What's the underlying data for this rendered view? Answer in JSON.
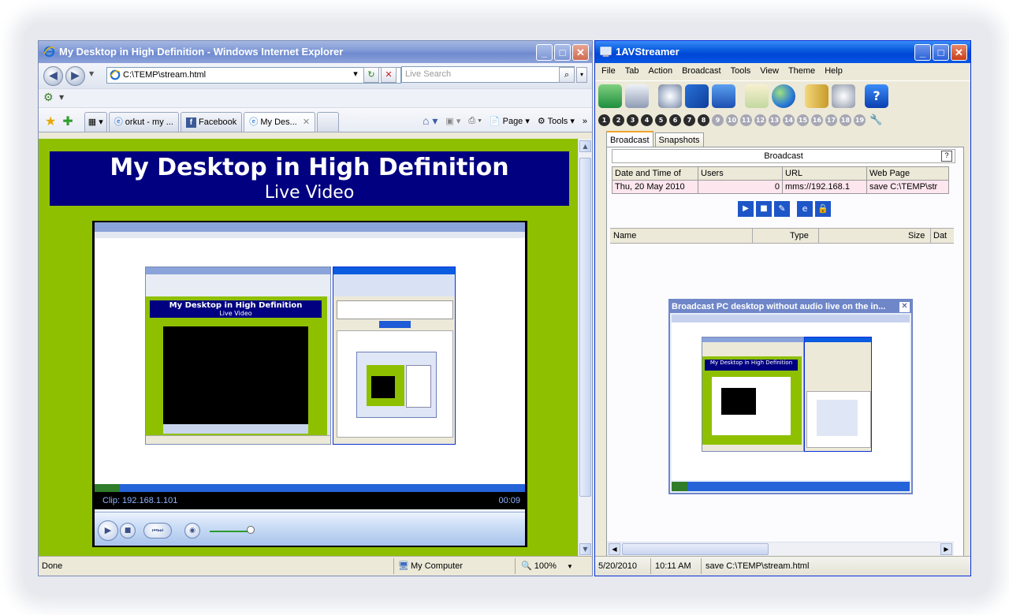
{
  "colors": {
    "ie_title": "#7f99d6",
    "av_title": "#0a5ce0",
    "page_green": "#8ec000",
    "banner_navy": "#000080"
  },
  "ie": {
    "title": "My Desktop in High Definition - Windows Internet Explorer",
    "address": "C:\\TEMP\\stream.html",
    "search_placeholder": "Live Search",
    "tabs": [
      {
        "label": "orkut - my ...",
        "icon": "ie-icon"
      },
      {
        "label": "Facebook",
        "icon": "facebook-icon"
      },
      {
        "label": "My Des...",
        "icon": "ie-icon",
        "active": true
      }
    ],
    "commands": {
      "page": "Page",
      "tools": "Tools"
    },
    "page": {
      "heading": "My Desktop in High Definition",
      "subheading": "Live Video"
    },
    "player": {
      "clip": "Clip: 192.168.1.101",
      "time": "00:09",
      "volume": 0.85
    },
    "status": {
      "text": "Done",
      "zone": "My Computer",
      "zoom": "100%"
    }
  },
  "av": {
    "title": "1AVStreamer",
    "menu": [
      "File",
      "Tab",
      "Action",
      "Broadcast",
      "Tools",
      "View",
      "Theme",
      "Help"
    ],
    "tabs": [
      "Broadcast",
      "Snapshots"
    ],
    "group_label": "Broadcast",
    "help_glyph": "?",
    "table": {
      "headers": [
        "Date and Time of",
        "Users",
        "URL",
        "Web Page"
      ],
      "row": [
        "Thu, 20 May 2010",
        "0",
        "mms://192.168.1",
        "save C:\\TEMP\\str"
      ]
    },
    "file_headers": [
      "Name",
      "Type",
      "Size",
      "Dat"
    ],
    "preview_title": "Broadcast PC desktop without audio live on the in...",
    "numbers": [
      "1",
      "2",
      "3",
      "4",
      "5",
      "6",
      "7",
      "8",
      "9",
      "10",
      "11",
      "12",
      "13",
      "14",
      "15",
      "16",
      "17",
      "18",
      "19"
    ],
    "status": {
      "date": "5/20/2010",
      "time": "10:11 AM",
      "msg": "save C:\\TEMP\\stream.html"
    }
  }
}
